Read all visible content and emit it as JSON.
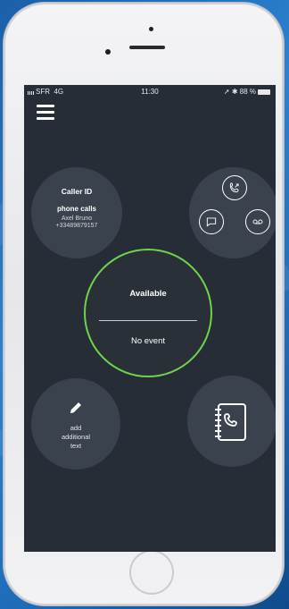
{
  "status_bar": {
    "carrier": "SFR",
    "network": "4G",
    "time": "11:30",
    "battery": "88 %"
  },
  "caller_id": {
    "title": "Caller ID",
    "subtitle": "phone calls",
    "name": "Axel Bruno",
    "number": "+33489879157"
  },
  "quick_actions": {
    "icons": [
      "call-forward-icon",
      "chat-bubble-icon",
      "voicemail-icon"
    ]
  },
  "presence": {
    "status": "Available",
    "event": "No event",
    "ring_color": "#6fd44a"
  },
  "add_text": {
    "line1": "add",
    "line2": "additional",
    "line3": "text"
  },
  "contacts": {
    "icon": "phone-book-icon"
  },
  "colors": {
    "screen_bg": "#262d36",
    "circle_bg": "#3a424d",
    "accent_green": "#6fd44a"
  }
}
